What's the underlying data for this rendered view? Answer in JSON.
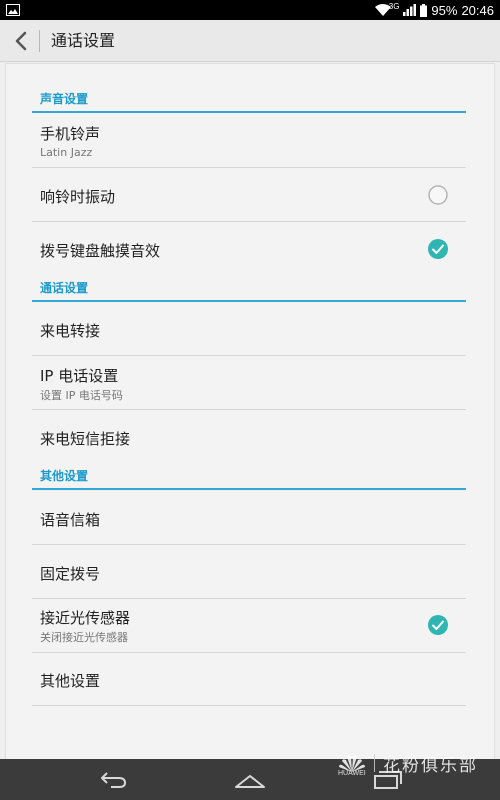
{
  "status": {
    "network": "3G",
    "battery": "95%",
    "time": "20:46"
  },
  "header": {
    "title": "通话设置"
  },
  "sections": [
    {
      "header": "声音设置",
      "items": [
        {
          "title": "手机铃声",
          "subtitle": "Latin Jazz"
        },
        {
          "title": "响铃时振动",
          "checked": false
        },
        {
          "title": "拨号键盘触摸音效",
          "checked": true
        }
      ]
    },
    {
      "header": "通话设置",
      "items": [
        {
          "title": "来电转接"
        },
        {
          "title": "IP 电话设置",
          "subtitle": "设置 IP 电话号码"
        },
        {
          "title": "来电短信拒接"
        }
      ]
    },
    {
      "header": "其他设置",
      "items": [
        {
          "title": "语音信箱"
        },
        {
          "title": "固定拨号"
        },
        {
          "title": "接近光传感器",
          "subtitle": "关闭接近光传感器",
          "checked": true
        },
        {
          "title": "其他设置"
        }
      ]
    }
  ],
  "watermark": {
    "text": "花粉俱乐部",
    "brand": "HUAWEI"
  },
  "colors": {
    "accent": "#33a9d6",
    "check": "#2fb6b2",
    "navbar": "#3b3b3b"
  },
  "icons": [
    "image-icon",
    "wifi-icon",
    "signal-icon",
    "battery-icon",
    "back-arrow-icon",
    "checkbox-checked-icon",
    "checkbox-unchecked-icon",
    "nav-back-icon",
    "nav-home-icon",
    "nav-recents-icon",
    "huawei-logo-icon"
  ]
}
